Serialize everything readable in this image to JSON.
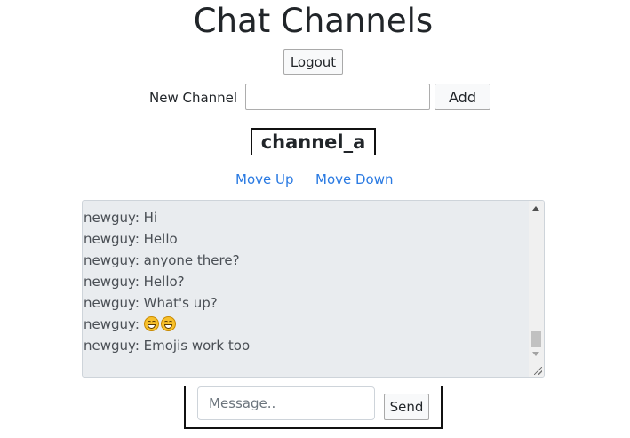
{
  "page": {
    "title": "Chat Channels",
    "logout_label": "Logout"
  },
  "new_channel": {
    "label": "New Channel",
    "value": "",
    "add_label": "Add"
  },
  "channel": {
    "name": "channel_a",
    "move_up_label": "Move Up",
    "move_down_label": "Move Down"
  },
  "messages": [
    {
      "text": "newguy: Hi"
    },
    {
      "text": "newguy: Hello"
    },
    {
      "text": "newguy: anyone there?"
    },
    {
      "text": "newguy: Hello?"
    },
    {
      "text": "newguy: What's up?"
    },
    {
      "text": "newguy: ",
      "emoji": "laughing-emoji",
      "emoji_count": 2
    },
    {
      "text": "newguy: Emojis work too"
    }
  ],
  "compose": {
    "placeholder": "Message..",
    "send_label": "Send"
  },
  "colors": {
    "link": "#2a7ae2",
    "chat_background": "#e9ecef"
  }
}
